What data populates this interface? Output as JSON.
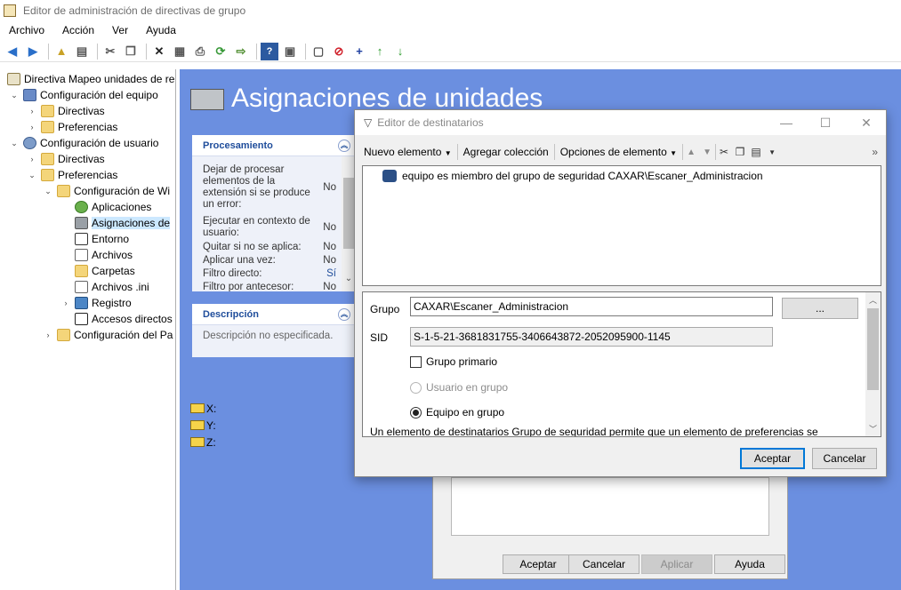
{
  "window": {
    "title": "Editor de administración de directivas de grupo"
  },
  "menu": [
    "Archivo",
    "Acción",
    "Ver",
    "Ayuda"
  ],
  "tree": {
    "items": [
      {
        "label": "Directiva Mapeo unidades de re",
        "icon": "policy"
      },
      {
        "label": "Configuración del equipo",
        "icon": "pc"
      },
      {
        "label": "Directivas",
        "icon": "folder"
      },
      {
        "label": "Preferencias",
        "icon": "folder"
      },
      {
        "label": "Configuración de usuario",
        "icon": "user"
      },
      {
        "label": "Directivas",
        "icon": "folder"
      },
      {
        "label": "Preferencias",
        "icon": "folder"
      },
      {
        "label": "Configuración de Wi",
        "icon": "folder"
      },
      {
        "label": "Aplicaciones",
        "icon": "app"
      },
      {
        "label": "Asignaciones de",
        "icon": "drive"
      },
      {
        "label": "Entorno",
        "icon": "env"
      },
      {
        "label": "Archivos",
        "icon": "file"
      },
      {
        "label": "Carpetas",
        "icon": "folder"
      },
      {
        "label": "Archivos .ini",
        "icon": "file"
      },
      {
        "label": "Registro",
        "icon": "reg"
      },
      {
        "label": "Accesos directos",
        "icon": "link"
      },
      {
        "label": "Configuración del Pa",
        "icon": "folder"
      }
    ]
  },
  "panel": {
    "heading": "Asignaciones de unidades",
    "procesamiento": {
      "title": "Procesamiento",
      "rows": [
        {
          "label": "Dejar de procesar elementos de la extensión si se produce un error:",
          "value": "No"
        },
        {
          "label": "Ejecutar en contexto de usuario:",
          "value": "No"
        },
        {
          "label": "Quitar si no se aplica:",
          "value": "No"
        },
        {
          "label": "Aplicar una vez:",
          "value": "No"
        },
        {
          "label": "Filtro directo:",
          "value": "Sí"
        },
        {
          "label": "Filtro por antecesor:",
          "value": "No"
        }
      ]
    },
    "descripcion": {
      "title": "Descripción",
      "text": "Descripción no especificada."
    },
    "drives": [
      "X:",
      "Y:",
      "Z:"
    ],
    "background_dialog": {
      "aceptar": "Aceptar",
      "cancelar": "Cancelar",
      "aplicar": "Aplicar",
      "ayuda": "Ayuda"
    }
  },
  "dialog": {
    "title": "Editor de destinatarios",
    "toolbar": {
      "nuevo_elemento": "Nuevo elemento",
      "agregar_coleccion": "Agregar colección",
      "opciones_elemento": "Opciones de elemento",
      "more": "»"
    },
    "targets": [
      "equipo es miembro del grupo de seguridad CAXAR\\Escaner_Administracion"
    ],
    "props": {
      "grupo_label": "Grupo",
      "grupo_value": "CAXAR\\Escaner_Administracion",
      "browse_label": "...",
      "sid_label": "SID",
      "sid_value": "S-1-5-21-3681831755-3406643872-2052095900-1145",
      "grupo_primario": "Grupo primario",
      "usuario_en_grupo": "Usuario en grupo",
      "equipo_en_grupo": "Equipo en grupo",
      "description": "Un elemento de destinatarios Grupo de seguridad permite que un elemento de preferencias se"
    },
    "aceptar": "Aceptar",
    "cancelar": "Cancelar"
  }
}
